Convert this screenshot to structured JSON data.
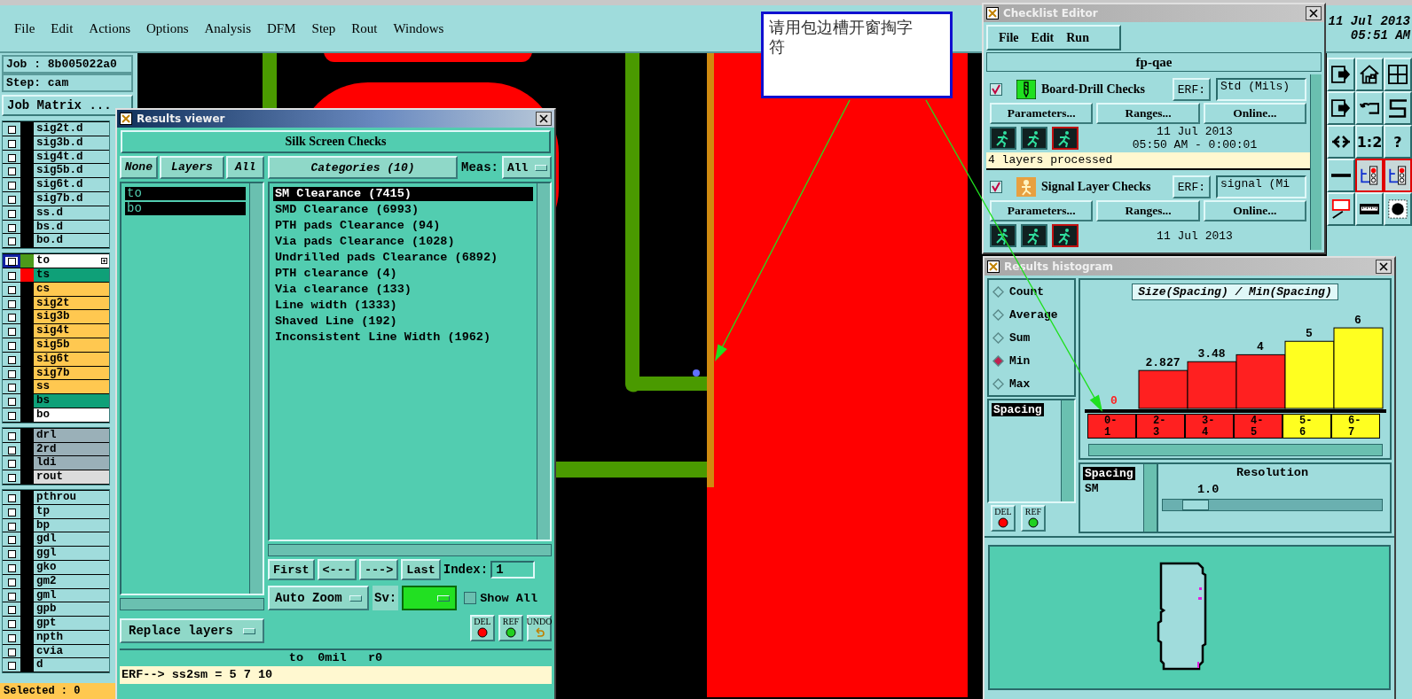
{
  "menu": [
    "File",
    "Edit",
    "Actions",
    "Options",
    "Analysis",
    "DFM",
    "Step",
    "Rout",
    "Windows"
  ],
  "clock": {
    "date": "11 Jul 2013",
    "time": "05:51 AM"
  },
  "job": {
    "job": "Job : 8b005022a0",
    "step": "Step: cam",
    "matrix_button": "Job Matrix ..."
  },
  "layer_groups": [
    [
      {
        "name": "sig2t.d",
        "color": "#a0dcdc",
        "active": false
      },
      {
        "name": "sig3b.d",
        "color": "#a0dcdc",
        "active": false
      },
      {
        "name": "sig4t.d",
        "color": "#a0dcdc",
        "active": false
      },
      {
        "name": "sig5b.d",
        "color": "#a0dcdc",
        "active": false
      },
      {
        "name": "sig6t.d",
        "color": "#a0dcdc",
        "active": false
      },
      {
        "name": "sig7b.d",
        "color": "#a0dcdc",
        "active": false
      },
      {
        "name": "ss.d",
        "color": "#a0dcdc",
        "active": false
      },
      {
        "name": "bs.d",
        "color": "#a0dcdc",
        "active": false
      },
      {
        "name": "bo.d",
        "color": "#a0dcdc",
        "active": false
      }
    ],
    [
      {
        "name": "to",
        "color": "#ffffff",
        "swatch": {
          "color": "#4c9a1a"
        },
        "active": true
      },
      {
        "name": "ts",
        "color": "#0fa078",
        "swatch": {
          "color": "#ff0000"
        },
        "active": false
      },
      {
        "name": "cs",
        "color": "#ffc850",
        "active": false
      },
      {
        "name": "sig2t",
        "color": "#ffc850",
        "active": false
      },
      {
        "name": "sig3b",
        "color": "#ffc850",
        "active": false
      },
      {
        "name": "sig4t",
        "color": "#ffc850",
        "active": false
      },
      {
        "name": "sig5b",
        "color": "#ffc850",
        "active": false
      },
      {
        "name": "sig6t",
        "color": "#ffc850",
        "active": false
      },
      {
        "name": "sig7b",
        "color": "#ffc850",
        "active": false
      },
      {
        "name": "ss",
        "color": "#ffc850",
        "active": false
      },
      {
        "name": "bs",
        "color": "#0fa078",
        "active": false
      },
      {
        "name": "bo",
        "color": "#ffffff",
        "active": false
      }
    ],
    [
      {
        "name": "drl",
        "color": "#9ab0b8",
        "active": false
      },
      {
        "name": "2rd",
        "color": "#9ab0b8",
        "active": false
      },
      {
        "name": "ldi",
        "color": "#9ab0b8",
        "active": false
      },
      {
        "name": "rout",
        "color": "#dcdcdc",
        "active": false
      }
    ],
    [
      {
        "name": "pthrou",
        "color": "#a0dcdc",
        "active": false
      },
      {
        "name": "tp",
        "color": "#a0dcdc",
        "active": false
      },
      {
        "name": "bp",
        "color": "#a0dcdc",
        "active": false
      },
      {
        "name": "gdl",
        "color": "#a0dcdc",
        "active": false
      },
      {
        "name": "ggl",
        "color": "#a0dcdc",
        "active": false
      },
      {
        "name": "gko",
        "color": "#a0dcdc",
        "active": false
      },
      {
        "name": "gm2",
        "color": "#a0dcdc",
        "active": false
      },
      {
        "name": "gml",
        "color": "#a0dcdc",
        "active": false
      },
      {
        "name": "gpb",
        "color": "#a0dcdc",
        "active": false
      },
      {
        "name": "gpt",
        "color": "#a0dcdc",
        "active": false
      },
      {
        "name": "npth",
        "color": "#a0dcdc",
        "active": false
      },
      {
        "name": "cvia",
        "color": "#a0dcdc",
        "active": false
      },
      {
        "name": "d",
        "color": "#a0dcdc",
        "active": false
      }
    ]
  ],
  "selected_count": "Selected : 0",
  "callout": {
    "text": "请用包边槽开窗掏字符"
  },
  "results_viewer": {
    "title": "Results viewer",
    "heading": "Silk Screen Checks",
    "layer_buttons": [
      "None",
      "Layers",
      "All"
    ],
    "layers": [
      {
        "name": "to",
        "selected": true
      },
      {
        "name": "bo",
        "selected": true
      }
    ],
    "categories_button": "Categories (10)",
    "meas_label": "Meas:",
    "meas_value": "All",
    "categories": [
      {
        "label": "SM Clearance (7415)",
        "selected": true
      },
      {
        "label": "SMD Clearance (6993)",
        "selected": false
      },
      {
        "label": "PTH pads Clearance (94)",
        "selected": false
      },
      {
        "label": "Via pads Clearance (1028)",
        "selected": false
      },
      {
        "label": "Undrilled pads Clearance (6892)",
        "selected": false
      },
      {
        "label": "PTH clearance (4)",
        "selected": false
      },
      {
        "label": "Via clearance (133)",
        "selected": false
      },
      {
        "label": "Line width (1333)",
        "selected": false
      },
      {
        "label": "Shaved Line (192)",
        "selected": false
      },
      {
        "label": "Inconsistent Line Width (1962)",
        "selected": false
      }
    ],
    "nav": [
      "First",
      "<---",
      "--->",
      "Last"
    ],
    "index_label": "Index:",
    "index_value": "1",
    "zoom_mode": "Auto Zoom",
    "sv_label": "Sv:",
    "show_all": {
      "label": "Show All",
      "checked": false
    },
    "replace_button": "Replace layers",
    "actions": [
      {
        "label": "DEL",
        "kind": "delete"
      },
      {
        "label": "REF",
        "kind": "refresh"
      },
      {
        "label": "UNDO",
        "kind": "undo"
      }
    ],
    "status": "to  0mil   r0",
    "erf_line": "ERF--> ss2sm = 5 7 10"
  },
  "checklist_editor": {
    "title": "Checklist Editor",
    "menu": [
      "File",
      "Edit",
      "Run"
    ],
    "checklist_name": "fp-qae",
    "checks": [
      {
        "name": "Board-Drill Checks",
        "kind": "drill",
        "checked": true,
        "erf_label": "ERF:",
        "erf_value": "Std (Mils)",
        "buttons": [
          "Parameters...",
          "Ranges...",
          "Online..."
        ],
        "date": "11 Jul 2013",
        "time": "05:50 AM - 0:00:01",
        "message": "4 layers processed"
      },
      {
        "name": "Signal Layer Checks",
        "kind": "signal",
        "checked": true,
        "erf_label": "ERF:",
        "erf_value": "signal (Mi",
        "buttons": [
          "Parameters...",
          "Ranges...",
          "Online..."
        ],
        "date": "11 Jul 2013"
      }
    ]
  },
  "histogram": {
    "title": "Results histogram",
    "modes": [
      {
        "label": "Count",
        "selected": false
      },
      {
        "label": "Average",
        "selected": false
      },
      {
        "label": "Sum",
        "selected": false
      },
      {
        "label": "Min",
        "selected": true
      },
      {
        "label": "Max",
        "selected": false
      }
    ],
    "measures": [
      {
        "label": "Spacing",
        "selected": true
      }
    ],
    "buttons": [
      {
        "label": "DEL",
        "kind": "delete"
      },
      {
        "label": "REF",
        "kind": "refresh"
      }
    ],
    "chart_data": {
      "type": "bar",
      "title": "Size(Spacing) / Min(Spacing)",
      "categories": [
        "0-1",
        "2-3",
        "3-4",
        "4-5",
        "5-6",
        "6-7"
      ],
      "values": [
        0,
        2.827,
        3.48,
        4,
        5,
        6
      ],
      "data_labels": true
    },
    "bins": [
      {
        "color": "#ff2020"
      },
      {
        "color": "#ff2020"
      },
      {
        "color": "#ff2020"
      },
      {
        "color": "#ff2020"
      },
      {
        "color": "#ffff20"
      },
      {
        "color": "#ffff20"
      }
    ],
    "layers": [
      {
        "label": "Spacing",
        "selected": true
      },
      {
        "label": "SM",
        "selected": false
      }
    ],
    "resolution": {
      "label": "Resolution",
      "value": "1.0",
      "level": 0.1
    }
  },
  "toolbar": [
    {
      "kind": "box-arrow"
    },
    {
      "kind": "house"
    },
    {
      "kind": "grid"
    },
    {
      "kind": "box-arrow"
    },
    {
      "kind": "loop"
    },
    {
      "kind": "s-curve"
    },
    {
      "kind": "split"
    },
    {
      "kind": "text",
      "label": "1:2"
    },
    {
      "kind": "text",
      "label": "?"
    },
    {
      "kind": "bar"
    },
    {
      "kind": "traffic-light"
    },
    {
      "kind": "traffic-light"
    },
    {
      "kind": "square-line"
    },
    {
      "kind": "ruler"
    },
    {
      "kind": "dot"
    }
  ]
}
